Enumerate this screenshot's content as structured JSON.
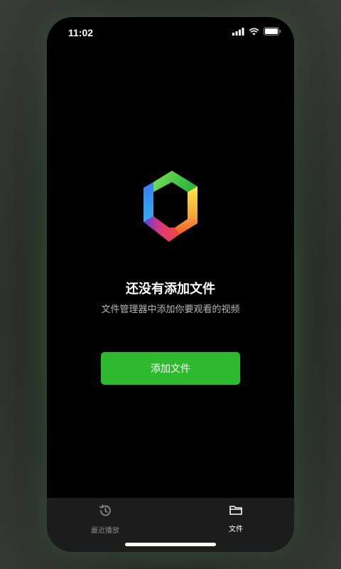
{
  "status_bar": {
    "time": "11:02"
  },
  "empty_state": {
    "title": "还没有添加文件",
    "subtitle": "文件管理器中添加你要观看的视频",
    "button_label": "添加文件"
  },
  "tab_bar": {
    "tabs": [
      {
        "label": "最近播放",
        "icon": "history-icon",
        "active": false
      },
      {
        "label": "文件",
        "icon": "folder-icon",
        "active": true
      }
    ]
  },
  "colors": {
    "accent": "#2dbb2d",
    "background": "#000000",
    "tabbar": "#1c1c1c"
  }
}
